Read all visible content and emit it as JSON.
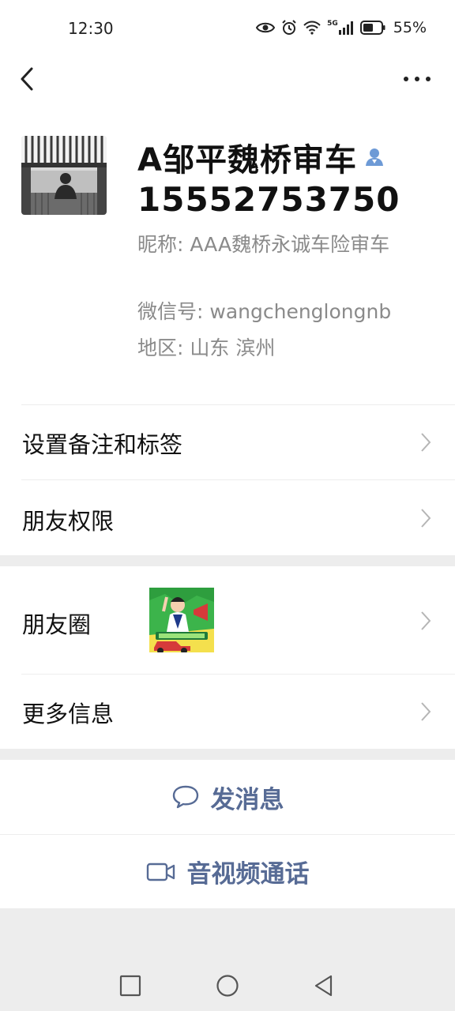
{
  "status_bar": {
    "time": "12:30",
    "network_label": "5G",
    "battery_percent": "55%",
    "icons": [
      "eye-icon",
      "alarm-icon",
      "wifi-icon",
      "signal-icon",
      "battery-icon"
    ]
  },
  "nav": {
    "back_icon": "back-icon",
    "more_icon": "more-icon"
  },
  "profile": {
    "name": "A邹平魏桥审车",
    "phone": "15552753750",
    "nickname": "昵称:  AAA魏桥永诚车险审车",
    "wechat_id": "微信号:  wangchenglongnb",
    "region": "地区:  山东  滨州",
    "verified_icon": "contact-person-icon"
  },
  "menu": {
    "remark_tags": "设置备注和标签",
    "friend_permissions": "朋友权限",
    "moments": "朋友圈",
    "more_info": "更多信息"
  },
  "actions": {
    "send_message": "发消息",
    "video_call": "音视频通话"
  },
  "colors": {
    "link_blue": "#576b95",
    "separator_gray": "#ededed",
    "secondary_text": "#8a8a8a"
  }
}
